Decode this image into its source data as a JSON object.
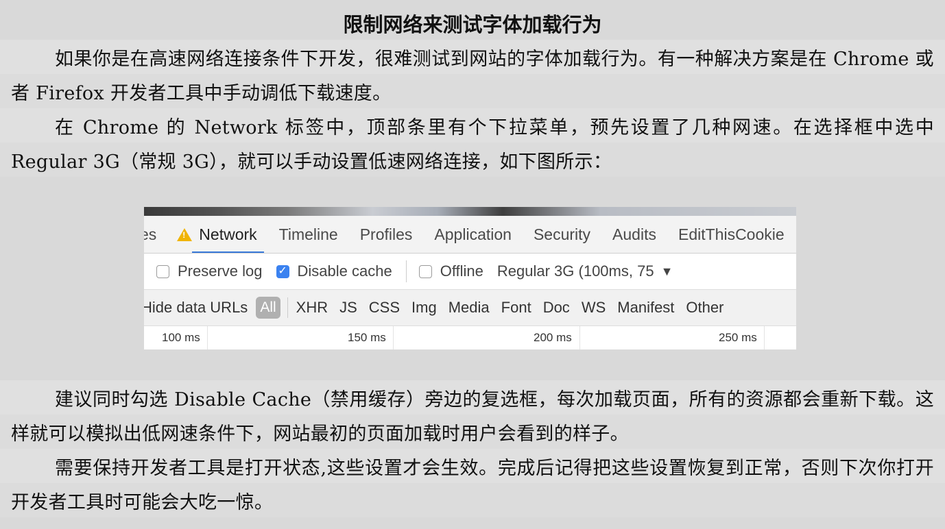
{
  "title": "限制网络来测试字体加载行为",
  "paragraphs": {
    "p1": "如果你是在高速网络连接条件下开发，很难测试到网站的字体加载行为。有一种解决方案是在 Chrome 或者 Firefox 开发者工具中手动调低下载速度。",
    "p2": "在 Chrome 的 Network 标签中，顶部条里有个下拉菜单，预先设置了几种网速。在选择框中选中 Regular 3G（常规 3G），就可以手动设置低速网络连接，如下图所示：",
    "p3": "建议同时勾选 Disable Cache（禁用缓存）旁边的复选框，每次加载页面，所有的资源都会重新下载。这样就可以模拟出低网速条件下，网站最初的页面加载时用户会看到的样子。",
    "p4": "需要保持开发者工具是打开状态,这些设置才会生效。完成后记得把这些设置恢复到正常，否则下次你打开开发者工具时可能会大吃一惊。"
  },
  "devtools": {
    "tabs": [
      "es",
      "Network",
      "Timeline",
      "Profiles",
      "Application",
      "Security",
      "Audits",
      "EditThisCookie"
    ],
    "active_tab_icon": "warning-icon",
    "toolbar": {
      "preserve_log": "Preserve log",
      "disable_cache": "Disable cache",
      "offline": "Offline",
      "throttle": "Regular 3G (100ms, 75",
      "throttle_arrow": "▼"
    },
    "filters": {
      "hide_urls": "Hide data URLs",
      "all": "All",
      "types": [
        "XHR",
        "JS",
        "CSS",
        "Img",
        "Media",
        "Font",
        "Doc",
        "WS",
        "Manifest",
        "Other"
      ]
    },
    "timeline_ticks": [
      "100 ms",
      "150 ms",
      "200 ms",
      "250 ms"
    ]
  }
}
